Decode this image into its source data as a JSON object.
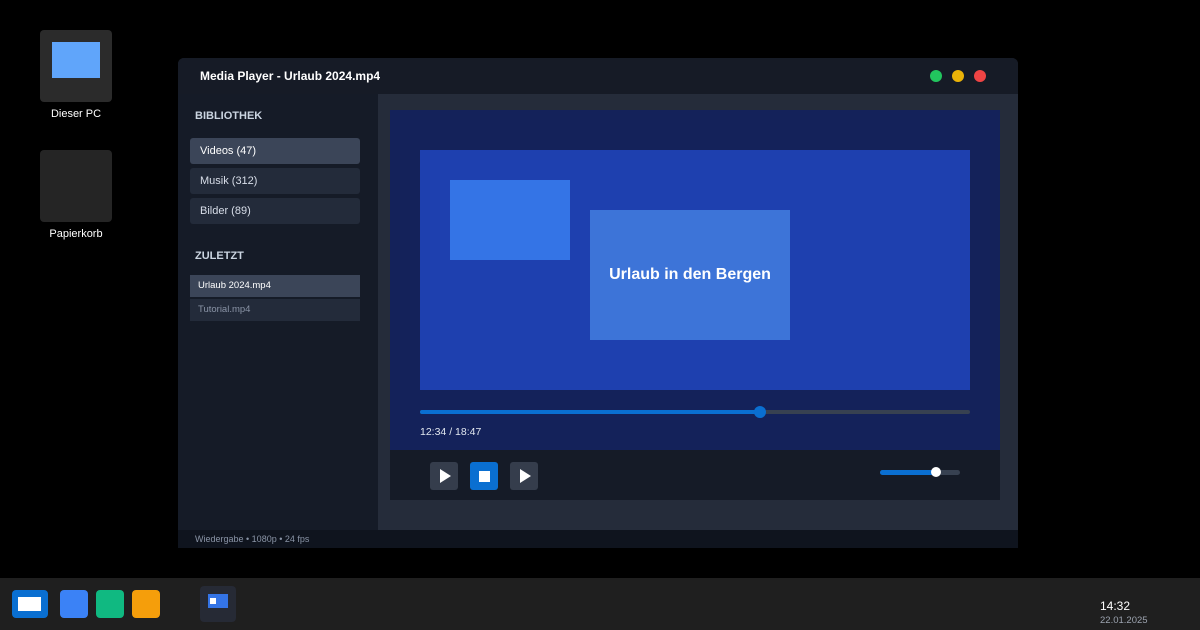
{
  "desktop": {
    "icons": [
      {
        "label": "Dieser PC"
      },
      {
        "label": "Papierkorb"
      }
    ]
  },
  "window": {
    "title": "Media Player - Urlaub 2024.mp4",
    "controls": {
      "close_color": "#ef4444",
      "minimize_color": "#eab308",
      "maximize_color": "#22c55e"
    }
  },
  "sidebar": {
    "library_title": "BIBLIOTHEK",
    "library_items": [
      {
        "label": "Videos (47)",
        "active": true
      },
      {
        "label": "Musik (312)",
        "active": false
      },
      {
        "label": "Bilder (89)",
        "active": false
      }
    ],
    "recent_title": "ZULETZT",
    "recent_items": [
      {
        "label": "Urlaub 2024.mp4",
        "active": true
      },
      {
        "label": "Tutorial.mp4",
        "active": false
      }
    ]
  },
  "player": {
    "video_caption": "Urlaub in den Bergen",
    "progress_fraction": 0.618,
    "time_display": "12:34 / 18:47",
    "volume_fraction": 0.7,
    "buttons": [
      {
        "icon": "play-icon"
      },
      {
        "icon": "stop-icon"
      },
      {
        "icon": "next-icon"
      }
    ]
  },
  "statusbar": {
    "text": "Wiedergabe • 1080p • 24 fps"
  },
  "taskbar": {
    "app_colors": [
      "#3b82f6",
      "#10b981",
      "#f59e0b"
    ],
    "clock_time": "14:32",
    "clock_date": "22.01.2025"
  },
  "colors": {
    "accent": "#0a6fd1",
    "desktop_bg": "#000000",
    "window_bg": "#1e2430"
  }
}
